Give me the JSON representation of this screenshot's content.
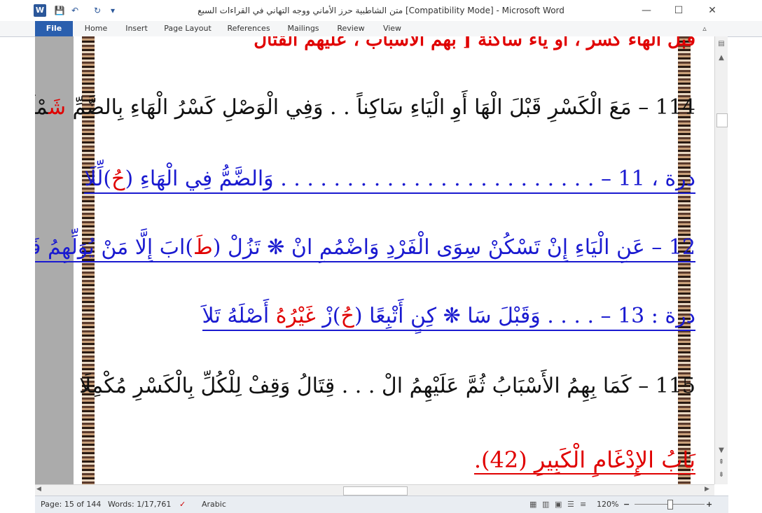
{
  "window": {
    "title": "متن الشاطبية حرز الأماني ووجه التهاني في القراءات السبع [Compatibility Mode]  -  Microsoft Word"
  },
  "quick_access": {
    "logo": "W",
    "save": "💾",
    "undo": "↶",
    "redo": "↻",
    "customize": "▾"
  },
  "window_controls": {
    "minimize": "—",
    "maximize": "☐",
    "close": "✕"
  },
  "ribbon": {
    "tabs": [
      "File",
      "Home",
      "Insert",
      "Page Layout",
      "References",
      "Mailings",
      "Review",
      "View"
    ],
    "collapse": "▵",
    "help": "?"
  },
  "document": {
    "partial_top": "قبل الهاء كسر ، أو ياء ساكنة [ بهم الأسباب ، عليهم القتال",
    "verse114": {
      "num": "114",
      "body": " – مَعَ الْكَسْرِ قَبْلَ الْهَا أَوِ الْيَاءِ سَاكِناً . . وَفِي الْوَصْلِ كَسْرُ الْهَاءِ بِالضَّمِّ ",
      "red": "شَ",
      "end": "مْلَلَا"
    },
    "durra11": {
      "prefix": "درة ، 11 – . . . . . . . . . . . . . . . . . . . . . . . . وَالضَّمُّ فِي الْهَاءِ (",
      "red": "حُ",
      "end": ")لِّلَا"
    },
    "durra12": {
      "prefix": "12 – عَنِ الْيَاءِ إِنْ تَسْكُنْ سِوَى الْفَرْدِ وَاضْمُمِ انْ ❋ تَزُلْ (",
      "red": "طَ",
      "end": ")ابَ إِلَّا مَنْ يُوَلِّهِمُ فَلاَ"
    },
    "durra13": {
      "prefix": "درة : 13 – . . . . وَقَبْلَ سَا ❋ كِنٍ أَتْبِعًا (",
      "red": "حُ",
      "mid": ")زْ ",
      "red2": "غَيْرُهُ",
      "end": " أَصْلَهُ تَلاَ"
    },
    "verse115": {
      "text": "115 – كَمَا بِهِمُ الأَسْبَابُ ثُمَّ عَلَيْهِمُ الْ . . . قِتَالُ وَقِفْ لِلْكُلِّ بِالْكَسْرِ مُكْمِلَا"
    },
    "heading": {
      "text": "بَابُ الإِدْغَامِ الْكَبِيرِ (42)."
    }
  },
  "status_bar": {
    "page": "Page: 15 of 144",
    "words": "Words: 1/17,761",
    "language": "Arabic",
    "zoom": "120%",
    "zoom_out": "−",
    "zoom_in": "+"
  },
  "colors": {
    "accent": "#2b579a",
    "verse_red": "#e00000",
    "durra_blue": "#1a1ad0"
  }
}
